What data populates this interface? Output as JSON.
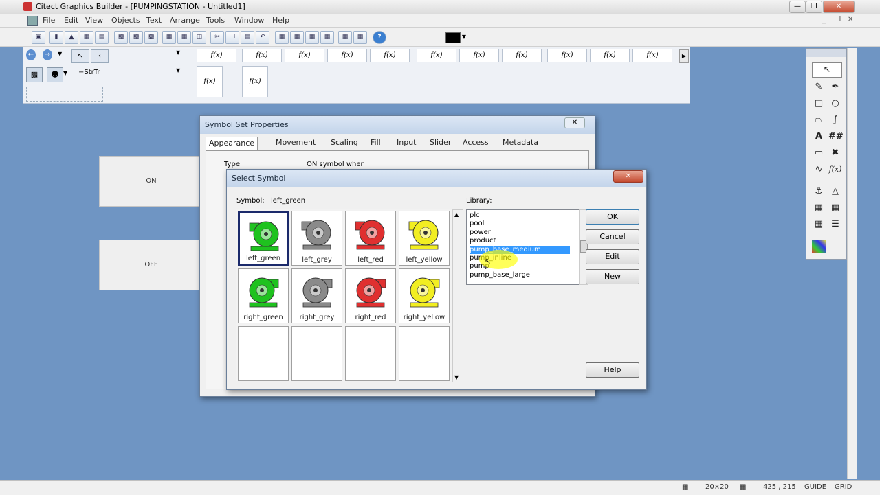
{
  "window": {
    "title": "Citect Graphics Builder - [PUMPINGSTATION - Untitled1]"
  },
  "menu": [
    "File",
    "Edit",
    "View",
    "Objects",
    "Text",
    "Arrange",
    "Tools",
    "Window",
    "Help"
  ],
  "panel": {
    "fx_label": "f(x)",
    "str_label": "=StrTr"
  },
  "canvas": {
    "on_label": "ON",
    "off_label": "OFF"
  },
  "symbol_set_dialog": {
    "title": "Symbol Set Properties",
    "tabs": [
      "Appearance",
      "Movement",
      "Scaling",
      "Fill",
      "Input",
      "Slider",
      "Access",
      "Metadata"
    ],
    "type_label": "Type",
    "on_symbol_label": "ON symbol when"
  },
  "select_symbol_dialog": {
    "title": "Select Symbol",
    "symbol_label": "Symbol:",
    "symbol_value": "left_green",
    "library_label": "Library:",
    "symbols": [
      {
        "name": "left_green",
        "color": "#1fc21f"
      },
      {
        "name": "left_grey",
        "color": "#8a8a8a"
      },
      {
        "name": "left_red",
        "color": "#e03030"
      },
      {
        "name": "left_yellow",
        "color": "#f2ee22"
      },
      {
        "name": "right_green",
        "color": "#1fc21f"
      },
      {
        "name": "right_grey",
        "color": "#8a8a8a"
      },
      {
        "name": "right_red",
        "color": "#e03030"
      },
      {
        "name": "right_yellow",
        "color": "#f2ee22"
      }
    ],
    "library_items": [
      "plc",
      "pool",
      "power",
      "product",
      "pump_base_medium",
      "pump_inline",
      "pump",
      "pump_base_large"
    ],
    "selected_library_item": "pump_base_medium",
    "buttons": {
      "ok": "OK",
      "cancel": "Cancel",
      "edit": "Edit",
      "new": "New",
      "help": "Help"
    }
  },
  "status": {
    "grid_size": "20×20",
    "coords": "425 , 215",
    "guide": "GUIDE",
    "grid": "GRID"
  },
  "colors": {
    "selection": "#3399ff",
    "highlight": "#ffff00",
    "desktop": "#6f95c3"
  }
}
